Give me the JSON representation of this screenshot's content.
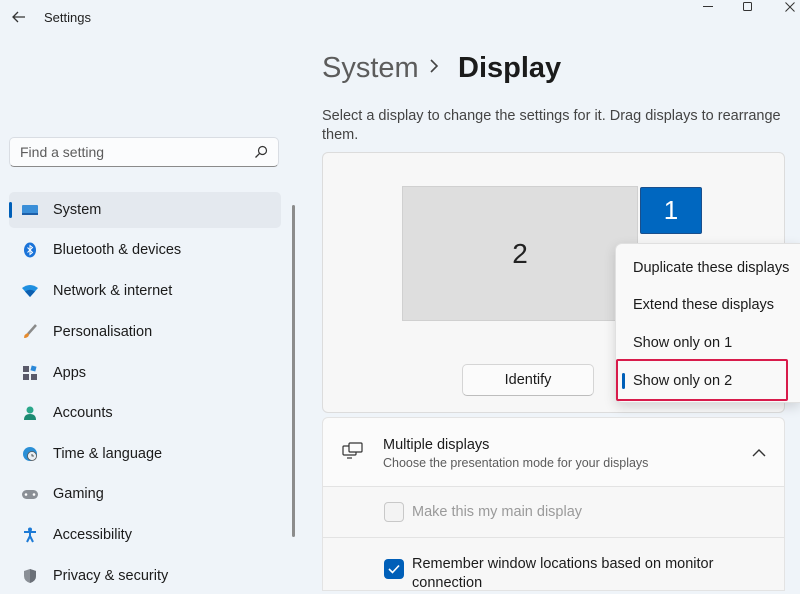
{
  "window": {
    "title": "Settings"
  },
  "search": {
    "placeholder": "Find a setting"
  },
  "sidebar": {
    "items": [
      {
        "label": "System",
        "icon": "system-icon",
        "selected": true
      },
      {
        "label": "Bluetooth & devices",
        "icon": "bluetooth-icon"
      },
      {
        "label": "Network & internet",
        "icon": "wifi-icon"
      },
      {
        "label": "Personalisation",
        "icon": "brush-icon"
      },
      {
        "label": "Apps",
        "icon": "apps-icon"
      },
      {
        "label": "Accounts",
        "icon": "person-icon"
      },
      {
        "label": "Time & language",
        "icon": "globe-clock-icon"
      },
      {
        "label": "Gaming",
        "icon": "gamepad-icon"
      },
      {
        "label": "Accessibility",
        "icon": "accessibility-icon"
      },
      {
        "label": "Privacy & security",
        "icon": "shield-icon"
      }
    ]
  },
  "header": {
    "parent": "System",
    "current": "Display"
  },
  "description": "Select a display to change the settings for it. Drag displays to rearrange them.",
  "arrangement": {
    "display_2_label": "2",
    "display_1_label": "1",
    "identify_label": "Identify"
  },
  "menu": {
    "items": [
      {
        "label": "Duplicate these displays"
      },
      {
        "label": "Extend these displays"
      },
      {
        "label": "Show only on 1"
      },
      {
        "label": "Show only on 2",
        "selected": true
      }
    ]
  },
  "multiple_displays": {
    "title": "Multiple displays",
    "subtitle": "Choose the presentation mode for your displays",
    "main_display_label": "Make this my main display",
    "main_display_checked": false,
    "remember_label": "Remember window locations based on monitor connection",
    "remember_checked": true
  },
  "colors": {
    "accent": "#005fb8",
    "selected_display": "#0067c0",
    "highlight_box": "#d81b4b"
  }
}
